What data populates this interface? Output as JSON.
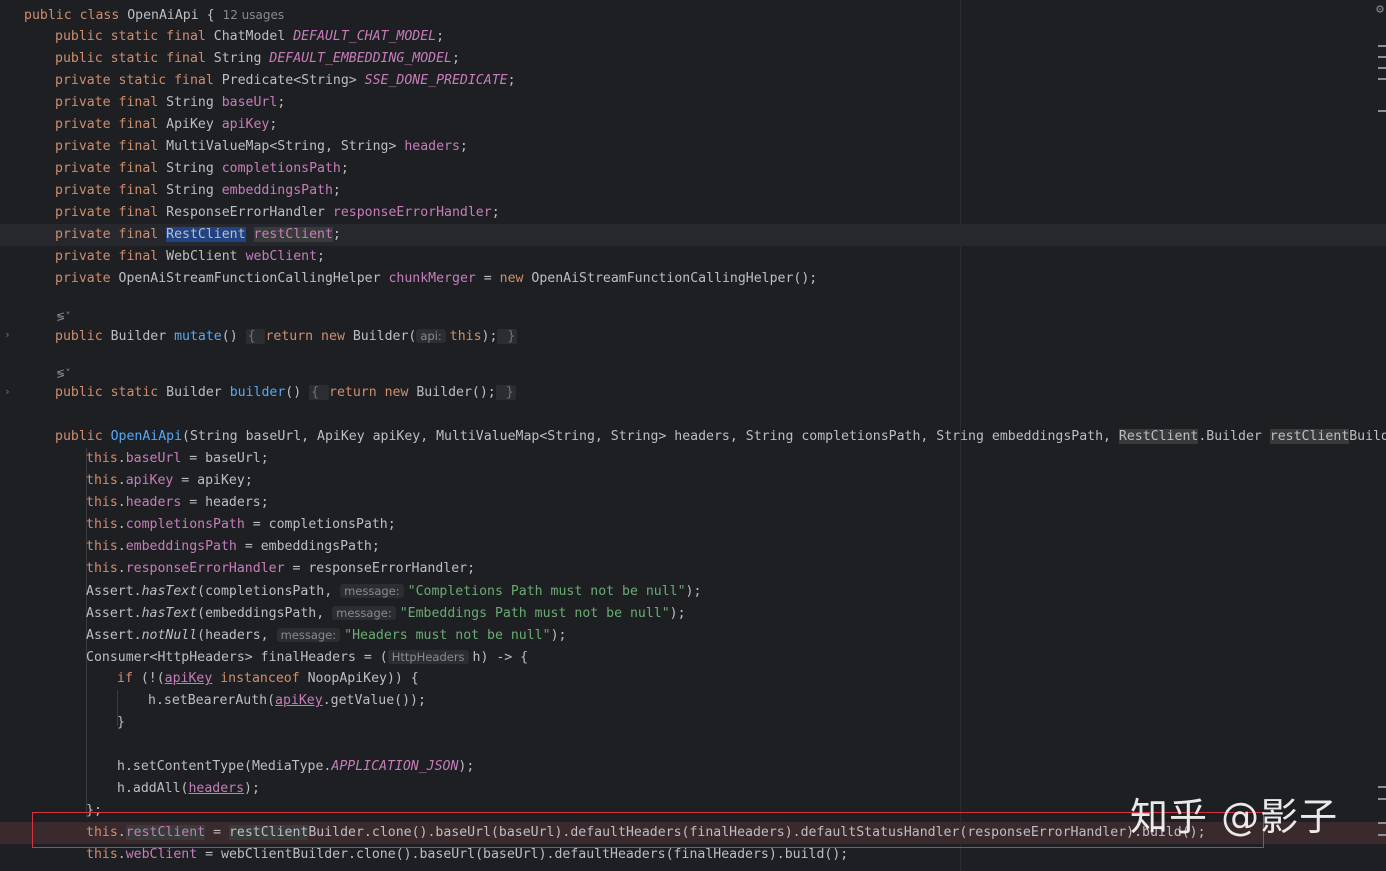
{
  "editor": {
    "usages": "12 usages",
    "lens_icon": "≶˅",
    "watermark": "知乎 @影子",
    "settings_icon": "⚙"
  },
  "code": {
    "l_class": {
      "kw": "public class ",
      "name": "OpenAiApi",
      "brace": " {"
    },
    "l1": {
      "kw": "public static final ",
      "type": "ChatModel ",
      "field": "DEFAULT_CHAT_MODEL",
      "end": ";"
    },
    "l2": {
      "kw": "public static final ",
      "type": "String ",
      "field": "DEFAULT_EMBEDDING_MODEL",
      "end": ";"
    },
    "l3": {
      "kw": "private static final ",
      "type": "Predicate<String> ",
      "field": "SSE_DONE_PREDICATE",
      "end": ";"
    },
    "l4": {
      "kw": "private final ",
      "type": "String ",
      "field": "baseUrl",
      "end": ";"
    },
    "l5": {
      "kw": "private final ",
      "type": "ApiKey ",
      "field": "apiKey",
      "end": ";"
    },
    "l6": {
      "kw": "private final ",
      "type": "MultiValueMap<String, String> ",
      "field": "headers",
      "end": ";"
    },
    "l7": {
      "kw": "private final ",
      "type": "String ",
      "field": "completionsPath",
      "end": ";"
    },
    "l8": {
      "kw": "private final ",
      "type": "String ",
      "field": "embeddingsPath",
      "end": ";"
    },
    "l9": {
      "kw": "private final ",
      "type": "ResponseErrorHandler ",
      "field": "responseErrorHandler",
      "end": ";"
    },
    "l10": {
      "kw": "private final ",
      "type": "RestClient",
      "sp": " ",
      "field": "restClient",
      "end": ";"
    },
    "l11": {
      "kw": "private final ",
      "type": "WebClient ",
      "field": "webClient",
      "end": ";"
    },
    "l12": {
      "kw": "private ",
      "type": "OpenAiStreamFunctionCallingHelper ",
      "field": "chunkMerger",
      "eq": " = ",
      "new": "new ",
      "rest": "OpenAiStreamFunctionCallingHelper();"
    },
    "l13": {
      "kw": "public ",
      "type": "Builder ",
      "method": "mutate",
      "paren": "()",
      "ob": "{ ",
      "ret": "return new ",
      "call": "Builder(",
      "hint": "api:",
      "arg": "this",
      "close": ");",
      "cb": " }"
    },
    "l14": {
      "kw": "public static ",
      "type": "Builder ",
      "method": "builder",
      "paren": "()",
      "ob": "{ ",
      "ret": "return new ",
      "call": "Builder();",
      "cb": " }"
    },
    "l15": {
      "kw": "public ",
      "method": "OpenAiApi",
      "params": "(String baseUrl, ApiKey apiKey, MultiValueMap<String, String> headers, String completionsPath, String embeddingsPath, ",
      "rc": "RestClient",
      "mid": ".Builder ",
      "rcb": "restClient",
      "rcb2": "Builder,"
    },
    "b1": {
      "this": "this",
      "dot": ".",
      "field": "baseUrl",
      "rest": " = baseUrl;"
    },
    "b2": {
      "this": "this",
      "dot": ".",
      "field": "apiKey",
      "rest": " = apiKey;"
    },
    "b3": {
      "this": "this",
      "dot": ".",
      "field": "headers",
      "rest": " = headers;"
    },
    "b4": {
      "this": "this",
      "dot": ".",
      "field": "completionsPath",
      "rest": " = completionsPath;"
    },
    "b5": {
      "this": "this",
      "dot": ".",
      "field": "embeddingsPath",
      "rest": " = embeddingsPath;"
    },
    "b6": {
      "this": "this",
      "dot": ".",
      "field": "responseErrorHandler",
      "rest": " = responseErrorHandler;"
    },
    "b7": {
      "cls": "Assert.",
      "m": "hasText",
      "a": "(completionsPath, ",
      "hint": "message:",
      "s": "\"Completions Path must not be null\"",
      "e": ");"
    },
    "b8": {
      "cls": "Assert.",
      "m": "hasText",
      "a": "(embeddingsPath, ",
      "hint": "message:",
      "s": "\"Embeddings Path must not be null\"",
      "e": ");"
    },
    "b9": {
      "cls": "Assert.",
      "m": "notNull",
      "a": "(headers, ",
      "hint": "message:",
      "s": "\"Headers must not be null\"",
      "e": ");"
    },
    "b10": {
      "a": "Consumer<HttpHeaders> finalHeaders = (",
      "hint": "HttpHeaders",
      "e": "h) -> {"
    },
    "b11": {
      "kw": "if ",
      "a": "(!(",
      "field": "apiKey",
      "kw2": " instanceof ",
      "e": "NoopApiKey)) {"
    },
    "b12": {
      "a": "h.setBearerAuth(",
      "field": "apiKey",
      "e": ".getValue());"
    },
    "b13": {
      "a": "}"
    },
    "b14": {
      "a": "h.setContentType(MediaType.",
      "sf": "APPLICATION_JSON",
      "e": ");"
    },
    "b15": {
      "a": "h.addAll(",
      "field": "headers",
      "e": ");"
    },
    "b16": {
      "a": "};"
    },
    "b17": {
      "this": "this",
      "dot": ".",
      "field": "restClient",
      "eq": " = ",
      "rcb": "restClient",
      "rest": "Builder.clone().baseUrl(baseUrl).defaultHeaders(finalHeaders).defaultStatusHandler(responseErrorHandler).build();"
    },
    "b18": {
      "this": "this",
      "dot": ".",
      "field": "webClient",
      "rest": " = webClientBuilder.clone().baseUrl(baseUrl).defaultHeaders(finalHeaders).build();"
    }
  }
}
